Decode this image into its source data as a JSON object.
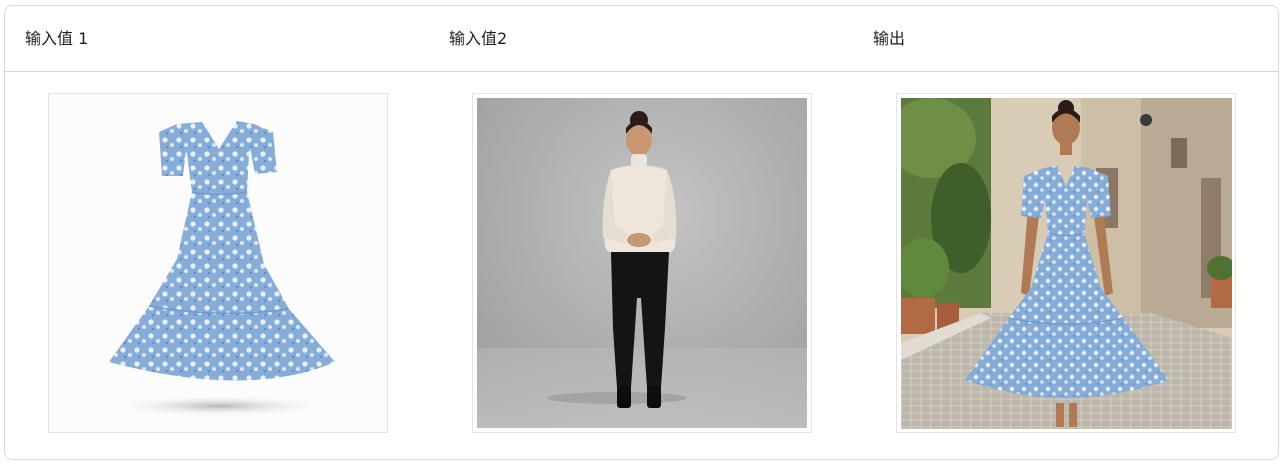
{
  "columns": [
    {
      "label": "输入值 1",
      "image": "floral-dress-product-photo"
    },
    {
      "label": "输入值2",
      "image": "woman-model-standing-photo"
    },
    {
      "label": "输出",
      "image": "woman-wearing-floral-dress-street-photo"
    }
  ],
  "colors": {
    "border": "#d8d8d8",
    "dress_blue": "#8fb3dc",
    "studio_gray": "#a9a9a9"
  }
}
